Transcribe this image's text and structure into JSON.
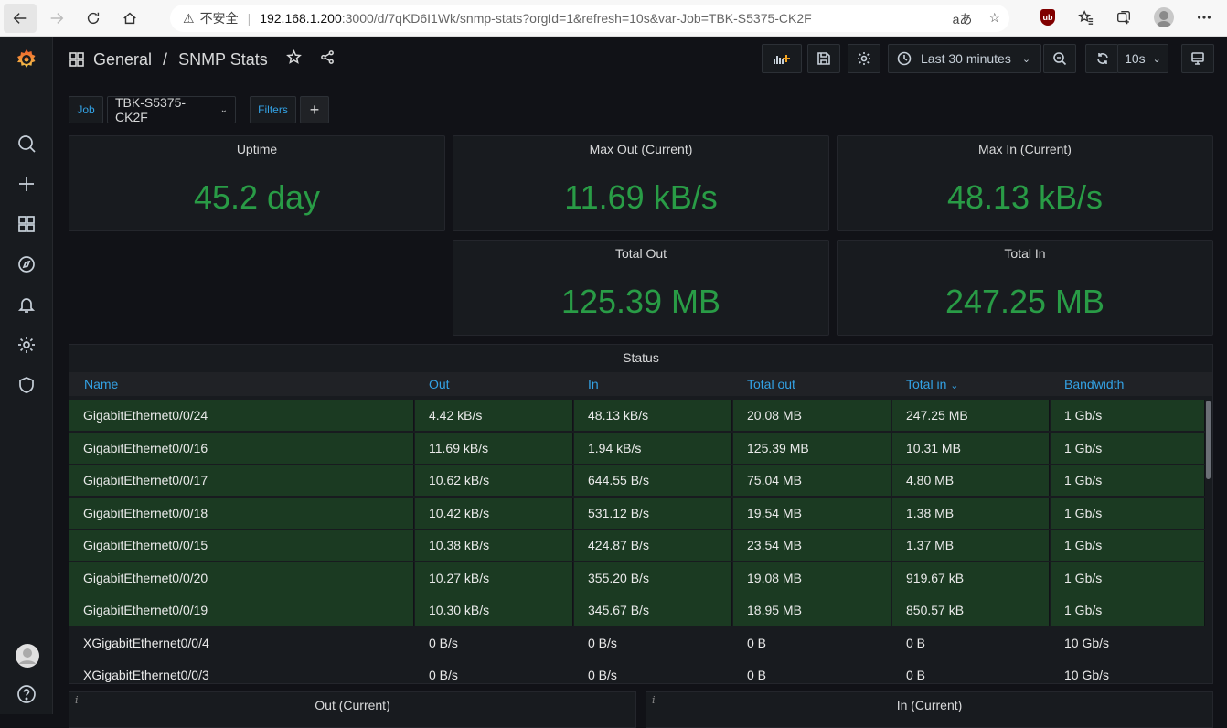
{
  "browser": {
    "insecure_label": "不安全",
    "url_host": "192.168.1.200",
    "url_rest": ":3000/d/7qKD6I1Wk/snmp-stats?orgId=1&refresh=10s&var-Job=TBK-S5375-CK2F",
    "read_aloud": "aあ"
  },
  "header": {
    "folder": "General",
    "separator": "/",
    "title": "SNMP Stats",
    "time_range": "Last 30 minutes",
    "refresh_interval": "10s"
  },
  "variables": {
    "job_label": "Job",
    "job_value": "TBK-S5375-CK2F",
    "filters_label": "Filters",
    "add_label": "+"
  },
  "stats": {
    "uptime": {
      "title": "Uptime",
      "value": "45.2 day"
    },
    "max_out": {
      "title": "Max Out (Current)",
      "value": "11.69 kB/s"
    },
    "max_in": {
      "title": "Max In (Current)",
      "value": "48.13 kB/s"
    },
    "total_out": {
      "title": "Total Out",
      "value": "125.39 MB"
    },
    "total_in": {
      "title": "Total In",
      "value": "247.25 MB"
    }
  },
  "status_table": {
    "title": "Status",
    "columns": [
      "Name",
      "Out",
      "In",
      "Total out",
      "Total in",
      "Bandwidth"
    ],
    "sort_indicator": "⌄",
    "rows": [
      [
        "GigabitEthernet0/0/24",
        "4.42 kB/s",
        "48.13 kB/s",
        "20.08 MB",
        "247.25 MB",
        "1 Gb/s"
      ],
      [
        "GigabitEthernet0/0/16",
        "11.69 kB/s",
        "1.94 kB/s",
        "125.39 MB",
        "10.31 MB",
        "1 Gb/s"
      ],
      [
        "GigabitEthernet0/0/17",
        "10.62 kB/s",
        "644.55 B/s",
        "75.04 MB",
        "4.80 MB",
        "1 Gb/s"
      ],
      [
        "GigabitEthernet0/0/18",
        "10.42 kB/s",
        "531.12 B/s",
        "19.54 MB",
        "1.38 MB",
        "1 Gb/s"
      ],
      [
        "GigabitEthernet0/0/15",
        "10.38 kB/s",
        "424.87 B/s",
        "23.54 MB",
        "1.37 MB",
        "1 Gb/s"
      ],
      [
        "GigabitEthernet0/0/20",
        "10.27 kB/s",
        "355.20 B/s",
        "19.08 MB",
        "919.67 kB",
        "1 Gb/s"
      ],
      [
        "GigabitEthernet0/0/19",
        "10.30 kB/s",
        "345.67 B/s",
        "18.95 MB",
        "850.57 kB",
        "1 Gb/s"
      ],
      [
        "XGigabitEthernet0/0/4",
        "0 B/s",
        "0 B/s",
        "0 B",
        "0 B",
        "10 Gb/s"
      ],
      [
        "XGigabitEthernet0/0/3",
        "0 B/s",
        "0 B/s",
        "0 B",
        "0 B",
        "10 Gb/s"
      ]
    ],
    "highlighted_rows": 7
  },
  "bottom_panels": {
    "out_title": "Out (Current)",
    "in_title": "In (Current)",
    "info_glyph": "i"
  },
  "colors": {
    "stat_value": "#299c46",
    "row_highlight": "#1b3a22",
    "accent_blue": "#33a2e5",
    "background": "#111217"
  }
}
